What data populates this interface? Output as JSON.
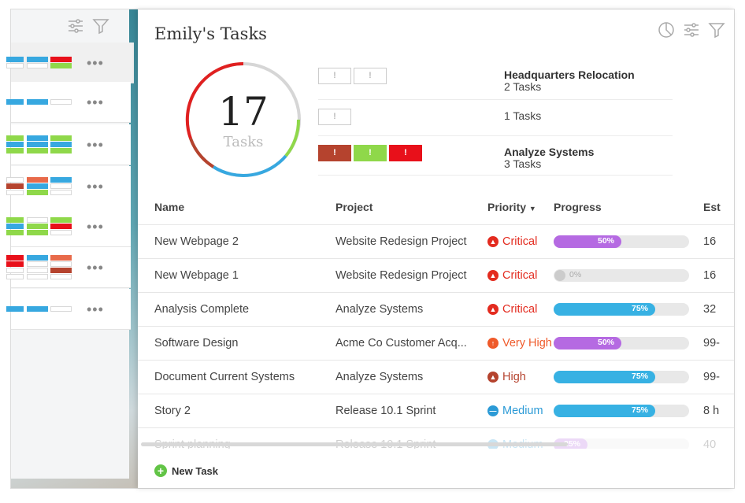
{
  "page": {
    "title": "Emily's Tasks"
  },
  "icons": {
    "chart": "pie-chart-icon",
    "settings": "sliders-icon",
    "filter": "filter-icon"
  },
  "colors": {
    "critical": "#e32b1f",
    "very_high": "#ef5a2a",
    "high": "#b5432e",
    "medium": "#2b9ad6",
    "purple": "#b56ae2",
    "blue": "#37b1e3",
    "green": "#8fd84a",
    "red": "#e8101a"
  },
  "donut": {
    "count": "17",
    "label": "Tasks"
  },
  "summary": [
    {
      "project": "Headquarters Relocation",
      "tasks": "2 Tasks",
      "pills": [
        "!",
        "!"
      ]
    },
    {
      "project": "",
      "tasks": "1 Tasks",
      "pills": [
        "!"
      ]
    },
    {
      "project": "Analyze Systems",
      "tasks": "3 Tasks",
      "pills": [
        "!",
        "!",
        "!"
      ]
    }
  ],
  "table": {
    "headers": {
      "name": "Name",
      "project": "Project",
      "priority": "Priority",
      "progress": "Progress",
      "est": "Est"
    },
    "rows": [
      {
        "name": "New Webpage 2",
        "project": "Website Redesign Project",
        "priority": "Critical",
        "progress": 50,
        "progress_label": "50%",
        "est": "16"
      },
      {
        "name": "New Webpage 1",
        "project": "Website Redesign Project",
        "priority": "Critical",
        "progress": 0,
        "progress_label": "0%",
        "est": "16"
      },
      {
        "name": "Analysis Complete",
        "project": "Analyze Systems",
        "priority": "Critical",
        "progress": 75,
        "progress_label": "75%",
        "est": "32"
      },
      {
        "name": "Software Design",
        "project": "Acme Co Customer Acq...",
        "priority": "Very High",
        "progress": 50,
        "progress_label": "50%",
        "est": "99-"
      },
      {
        "name": "Document Current Systems",
        "project": "Analyze Systems",
        "priority": "High",
        "progress": 75,
        "progress_label": "75%",
        "est": "99-"
      },
      {
        "name": "Story 2",
        "project": "Release 10.1 Sprint",
        "priority": "Medium",
        "progress": 75,
        "progress_label": "75%",
        "est": "8 h"
      },
      {
        "name": "Sprint planning",
        "project": "Release 10.1 Sprint",
        "priority": "Medium",
        "progress": 25,
        "progress_label": "25%",
        "est": "40"
      }
    ]
  },
  "footer": {
    "new_task": "New Task"
  }
}
